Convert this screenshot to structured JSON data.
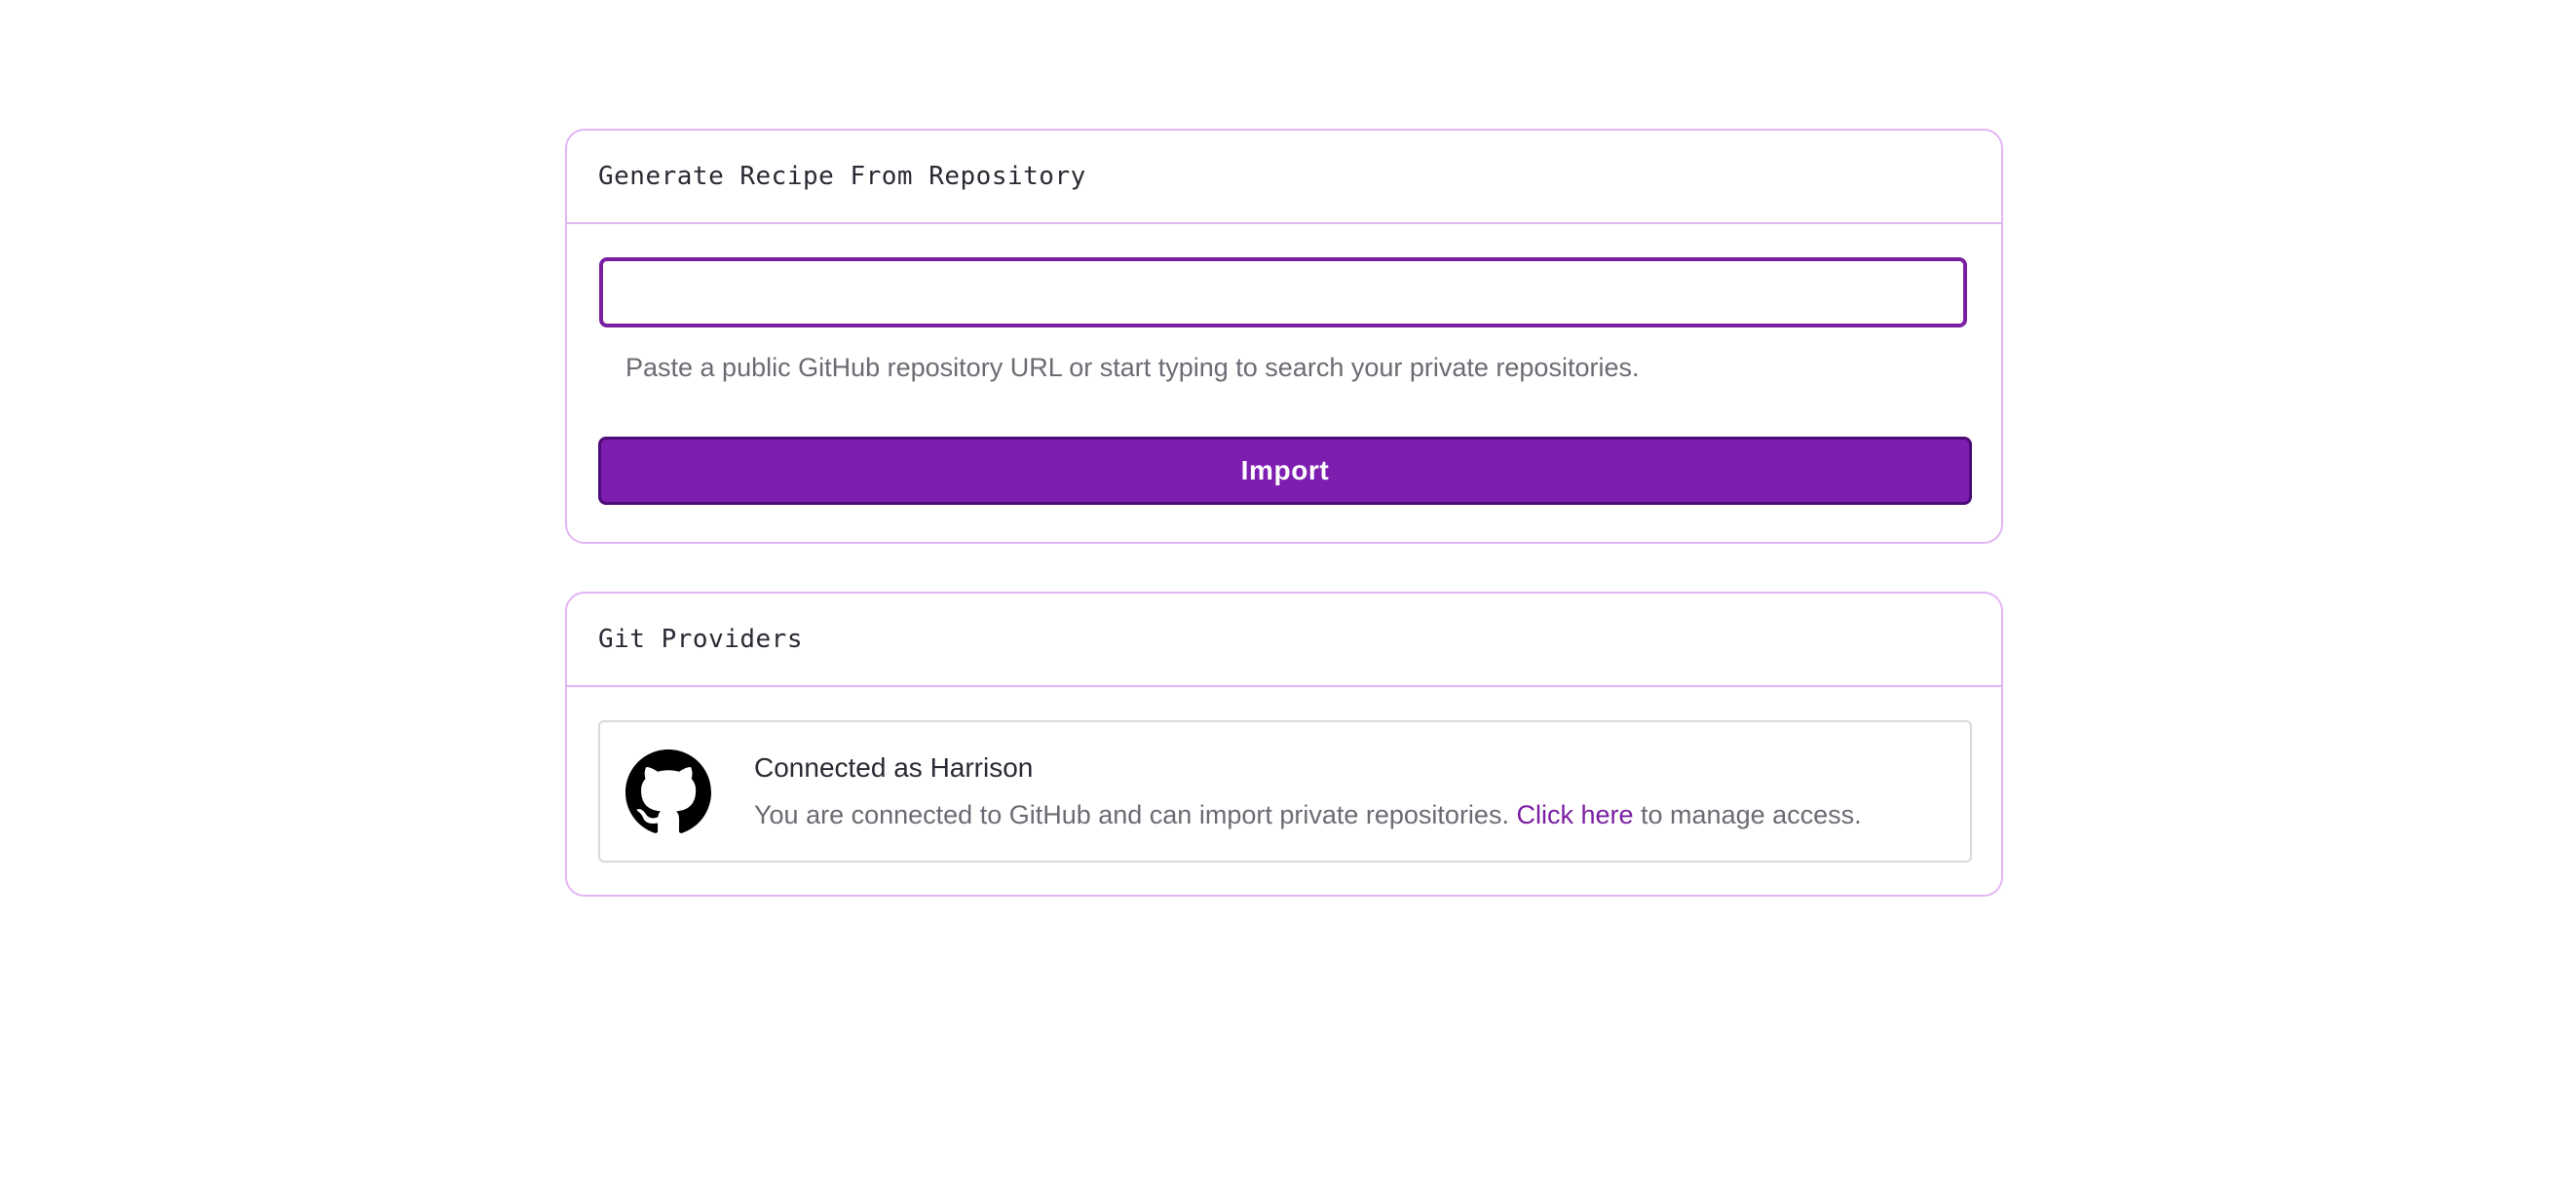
{
  "recipe": {
    "title": "Generate Recipe From Repository",
    "input_value": "",
    "input_placeholder": "",
    "help_text": "Paste a public GitHub repository URL or start typing to search your private repositories.",
    "import_label": "Import"
  },
  "git": {
    "title": "Git Providers",
    "provider": {
      "icon": "github-icon",
      "title": "Connected as Harrison",
      "desc_before": "You are connected to GitHub and can import private repositories.",
      "link_text": "Click here",
      "desc_after": "to manage access."
    }
  },
  "colors": {
    "accent": "#7d1eb1",
    "accent_border": "#4d0d78",
    "card_border": "#e2b6f3",
    "muted_text": "#6b6b73"
  }
}
